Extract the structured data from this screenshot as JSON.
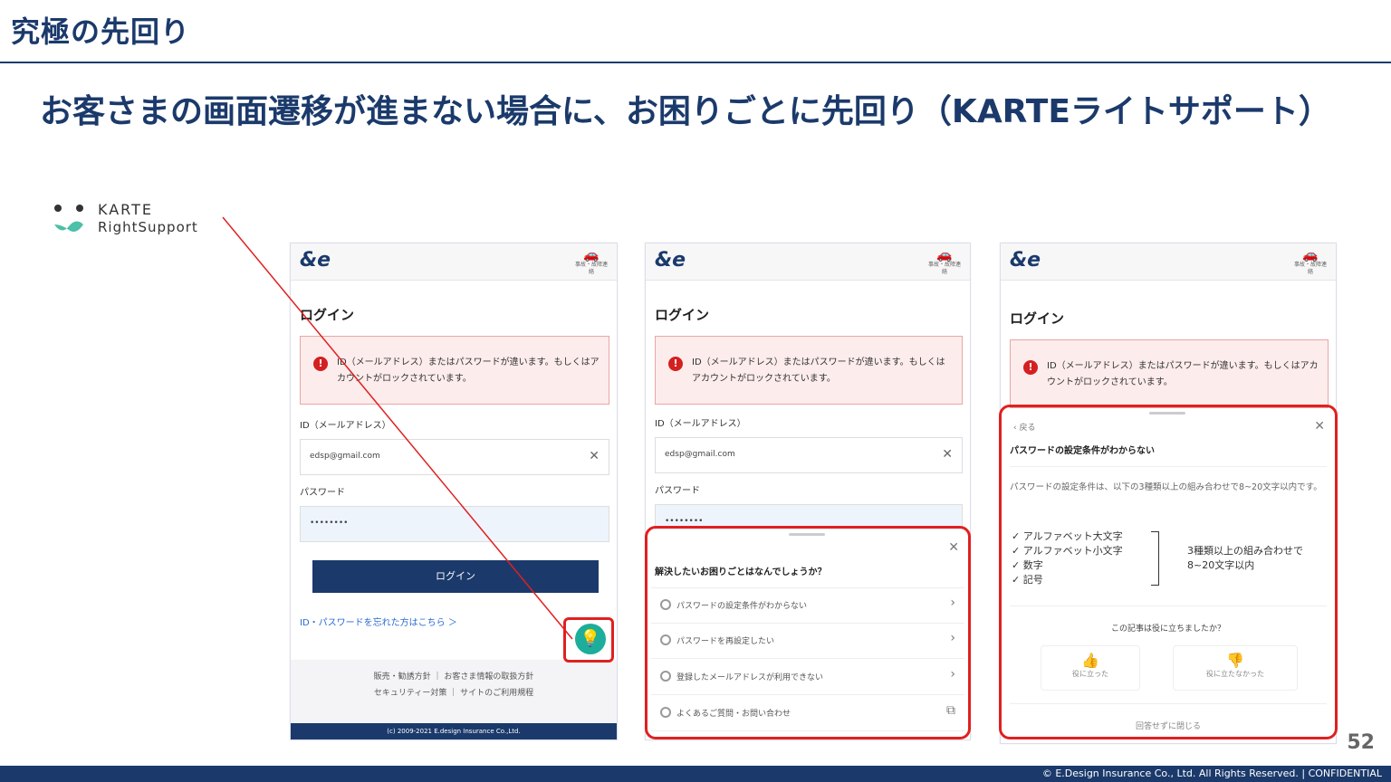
{
  "slide": {
    "title": "究極の先回り",
    "headline": "お客さまの画面遷移が進まない場合に、お困りごとに先回り（KARTEライトサポート）",
    "page_number": "52",
    "footer": "© E.Design Insurance Co., Ltd. All Rights Reserved. | CONFIDENTIAL"
  },
  "logo": {
    "line1": "KARTE",
    "line2": "RightSupport"
  },
  "phone_common": {
    "brand": "&e",
    "header_icon_label": "事故・故障連絡",
    "login_heading": "ログイン",
    "error_message": "ID（メールアドレス）またはパスワードが違います。もしくはアカウントがロックされています。",
    "id_label": "ID（メールアドレス）",
    "id_value": "edsp@gmail.com",
    "password_label": "パスワード",
    "password_value": "••••••••",
    "login_button": "ログイン",
    "forgot_link": "ID・パスワードを忘れた方はこちら ＞",
    "footer_links": [
      "販売・勧誘方針 ｜ お客さま情報の取扱方針",
      "セキュリティー対策 ｜ サイトのご利用規程"
    ],
    "copyright": "(c) 2009-2021 E.design Insurance Co.,Ltd."
  },
  "sheet1": {
    "title": "解決したいお困りごとはなんでしょうか？",
    "items": [
      "パスワードの設定条件がわからない",
      "パスワードを再設定したい",
      "登録したメールアドレスが利用できない",
      "よくあるご質問・お問い合わせ"
    ]
  },
  "sheet2": {
    "back": "戻る",
    "title": "パスワードの設定条件がわからない",
    "body": "パスワードの設定条件は、以下の3種類以上の組み合わせで8~20文字以内です。",
    "checks": [
      "✓ アルファベット大文字",
      "✓ アルファベット小文字",
      "✓ 数字",
      "✓ 記号"
    ],
    "rule_line1": "3種類以上の組み合わせで",
    "rule_line2": "8~20文字以内",
    "feedback_question": "この記事は役に立ちましたか？",
    "yes": "役に立った",
    "no": "役に立たなかった",
    "close": "回答せずに閉じる"
  },
  "colors": {
    "navy": "#1b3a6b",
    "red_highlight": "#e02020",
    "fab": "#1cae9a"
  }
}
